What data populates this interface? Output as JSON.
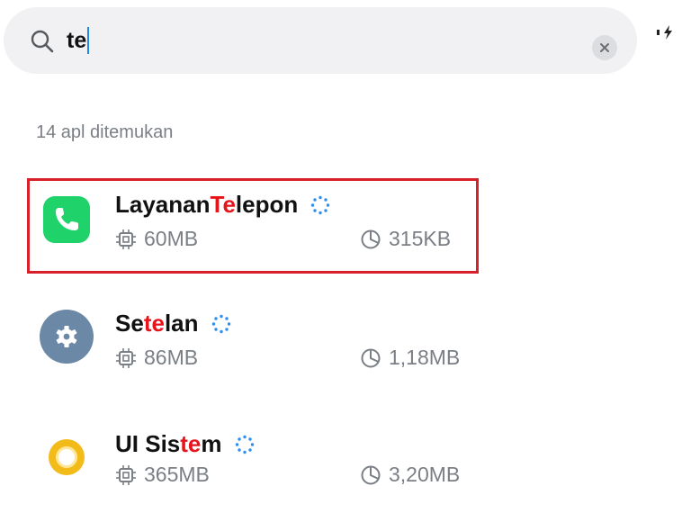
{
  "search": {
    "query": "te",
    "clear_label": "×"
  },
  "results": {
    "count_text": "14 apl ditemukan"
  },
  "apps": [
    {
      "name_prefix": "Layanan ",
      "name_match": "Te",
      "name_suffix": "lepon",
      "memory": "60MB",
      "storage": "315KB",
      "icon": "phone-icon"
    },
    {
      "name_prefix": "Se",
      "name_match": "te",
      "name_suffix": "lan",
      "memory": "86MB",
      "storage": "1,18MB",
      "icon": "gear-icon"
    },
    {
      "name_prefix": "UI Sis",
      "name_match": "te",
      "name_suffix": "m",
      "memory": "365MB",
      "storage": "3,20MB",
      "icon": "system-ui-icon"
    }
  ],
  "colors": {
    "highlight": "#e8141c",
    "phone_icon_bg": "#1fd36a",
    "settings_icon_bg": "#6b88a6",
    "system_ui_icon": "#f2bb1a",
    "annotation_box": "#d8202a"
  }
}
